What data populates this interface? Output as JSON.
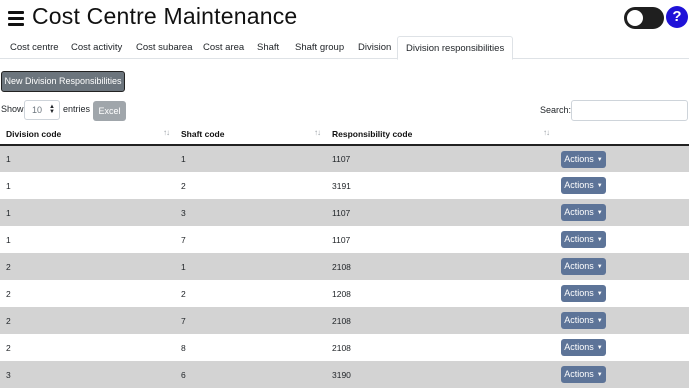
{
  "header": {
    "title": "Cost Centre Maintenance",
    "help_label": "?"
  },
  "tabs": [
    {
      "label": "Cost centre",
      "active": false
    },
    {
      "label": "Cost activity",
      "active": false
    },
    {
      "label": "Cost subarea",
      "active": false
    },
    {
      "label": "Cost area",
      "active": false
    },
    {
      "label": "Shaft",
      "active": false
    },
    {
      "label": "Shaft group",
      "active": false
    },
    {
      "label": "Division",
      "active": false
    },
    {
      "label": "Division responsibilities",
      "active": true
    }
  ],
  "toolbar": {
    "new_label": "New Division Responsibilities",
    "show_label": "Show",
    "entries_value": "10",
    "entries_label": "entries",
    "excel_label": "Excel",
    "search_label": "Search:",
    "search_value": ""
  },
  "table": {
    "columns": [
      "Division code",
      "Shaft code",
      "Responsibility code",
      ""
    ],
    "rows": [
      {
        "division": "1",
        "shaft": "1",
        "responsibility": "1107",
        "action": "Actions"
      },
      {
        "division": "1",
        "shaft": "2",
        "responsibility": "3191",
        "action": "Actions"
      },
      {
        "division": "1",
        "shaft": "3",
        "responsibility": "1107",
        "action": "Actions"
      },
      {
        "division": "1",
        "shaft": "7",
        "responsibility": "1107",
        "action": "Actions"
      },
      {
        "division": "2",
        "shaft": "1",
        "responsibility": "2108",
        "action": "Actions"
      },
      {
        "division": "2",
        "shaft": "2",
        "responsibility": "1208",
        "action": "Actions"
      },
      {
        "division": "2",
        "shaft": "7",
        "responsibility": "2108",
        "action": "Actions"
      },
      {
        "division": "2",
        "shaft": "8",
        "responsibility": "2108",
        "action": "Actions"
      },
      {
        "division": "3",
        "shaft": "6",
        "responsibility": "3190",
        "action": "Actions"
      }
    ]
  },
  "colors": {
    "stripe": "#d3d3d3",
    "actions_button": "#5d7498",
    "help_button": "#1f12d8",
    "new_button": "#6c757d"
  }
}
